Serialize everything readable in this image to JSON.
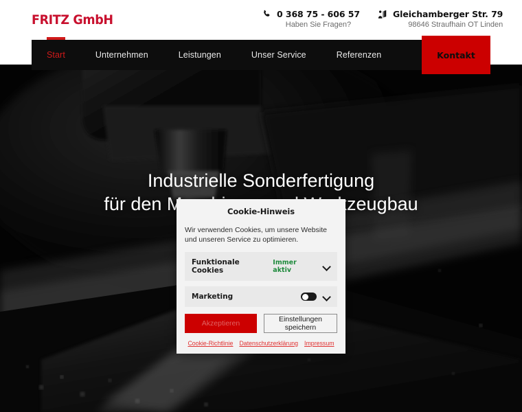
{
  "site": {
    "logo": "FRITZ GmbH",
    "brand_color": "#c8102e",
    "accent_color": "#cc0000"
  },
  "header": {
    "phone": {
      "icon": "phone-icon",
      "number": "0 368 75 - 606 57",
      "subtitle": "Haben Sie Fragen?"
    },
    "address": {
      "icon": "location-pin-icon",
      "street": "Gleichamberger Str. 79",
      "city": "98646 Straufhain OT Linden"
    }
  },
  "nav": {
    "items": [
      {
        "label": "Start",
        "active": true
      },
      {
        "label": "Unternehmen",
        "active": false
      },
      {
        "label": "Leistungen",
        "active": false
      },
      {
        "label": "Unser Service",
        "active": false
      },
      {
        "label": "Referenzen",
        "active": false
      }
    ],
    "cta": "Kontakt"
  },
  "hero": {
    "title_line1": "Industrielle Sonderfertigung",
    "title_line2": "für den Maschinen- und Werkzeugbau"
  },
  "cookie": {
    "title": "Cookie-Hinweis",
    "description": "Wir verwenden Cookies, um unsere Website und unseren Service zu optimieren.",
    "rows": [
      {
        "label": "Funktionale Cookies",
        "status": "Immer aktiv",
        "status_color": "#1e8a3c",
        "has_toggle": false
      },
      {
        "label": "Marketing",
        "status": "",
        "has_toggle": true,
        "toggle_on": false
      }
    ],
    "accept_label": "Akzeptieren",
    "save_label": "Einstellungen speichern",
    "links": [
      "Cookie-Richtlinie",
      "Datenschutzerklärung",
      "Impressum"
    ]
  }
}
